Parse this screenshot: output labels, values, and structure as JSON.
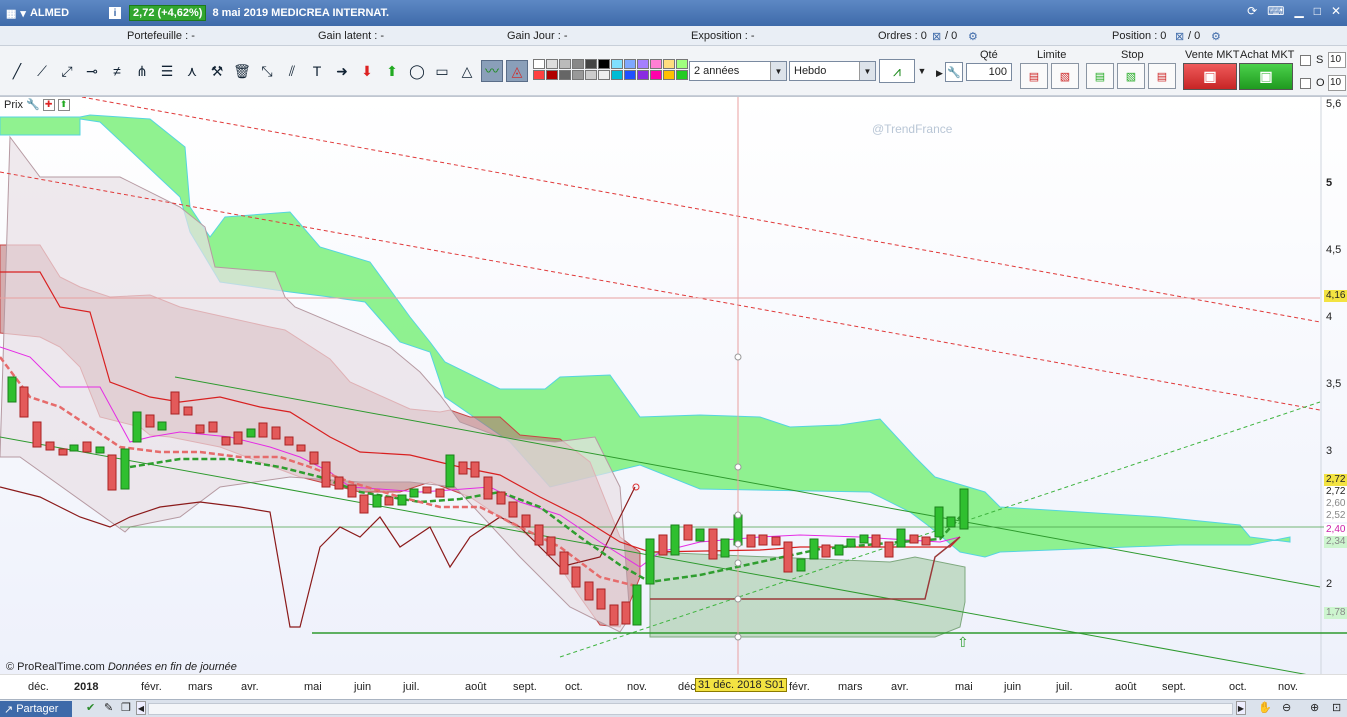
{
  "title_bar": {
    "symbol": "ALMED",
    "info_icon": "i",
    "change": "2,72 (+4,62%)",
    "name": "8 mai 2019 MEDICREA INTERNAT."
  },
  "status": {
    "portefeuille": "Portefeuille : -",
    "gain_latent": "Gain latent : -",
    "gain_jour": "Gain Jour : -",
    "exposition": "Exposition : -",
    "ordres": "Ordres : 0",
    "ordres_zero": "/ 0",
    "position": "Position : 0",
    "position_zero": "/ 0"
  },
  "toolbar": {
    "period": "2 années",
    "timeframe": "Hebdo"
  },
  "order_panel": {
    "qte_label": "Qté",
    "qte_value": "100",
    "limite_label": "Limite",
    "stop_label": "Stop",
    "vente_label": "Vente MKT",
    "achat_label": "Achat MKT",
    "s_label": "S",
    "o_label": "O",
    "s_value": "10",
    "o_value": "10"
  },
  "chart": {
    "legend_label": "Prix",
    "watermark": "@TrendFrance",
    "copyright": "© ProRealTime.com",
    "copyright_note": "Données en fin de journée",
    "crosshair_date": "31 déc. 2018 S01",
    "price_ticks": [
      "5,6",
      "5",
      "4,5",
      "4",
      "3,5",
      "3",
      "2"
    ],
    "tags": [
      {
        "text": "4,16",
        "bg": "#f3e342"
      },
      {
        "text": "2,72",
        "bg": "#f3e342"
      },
      {
        "text": "2,72",
        "bg": "#ffffff"
      },
      {
        "text": "2,60",
        "bg": "#ffffff"
      },
      {
        "text": "2,52",
        "bg": "#ffffff"
      },
      {
        "text": "2,40",
        "bg": "#ffffff"
      },
      {
        "text": "2,34",
        "bg": "#cdf5cf"
      },
      {
        "text": "1,78",
        "bg": "#cdf5cf"
      }
    ],
    "x_labels": [
      "déc.",
      "2018",
      "févr.",
      "mars",
      "avr.",
      "mai",
      "juin",
      "juil.",
      "août",
      "sept.",
      "oct.",
      "nov.",
      "déc.",
      "févr.",
      "mars",
      "avr.",
      "mai",
      "juin",
      "juil.",
      "août",
      "sept.",
      "oct.",
      "nov."
    ]
  },
  "bottom": {
    "share_label": "Partager"
  },
  "colors": {
    "cloud_green": "#7cf07c",
    "cloud_red": "#c58a8a",
    "up_candle": "#2fbf2f",
    "down_candle": "#e35a5a",
    "accent": "#3e6aa9"
  }
}
